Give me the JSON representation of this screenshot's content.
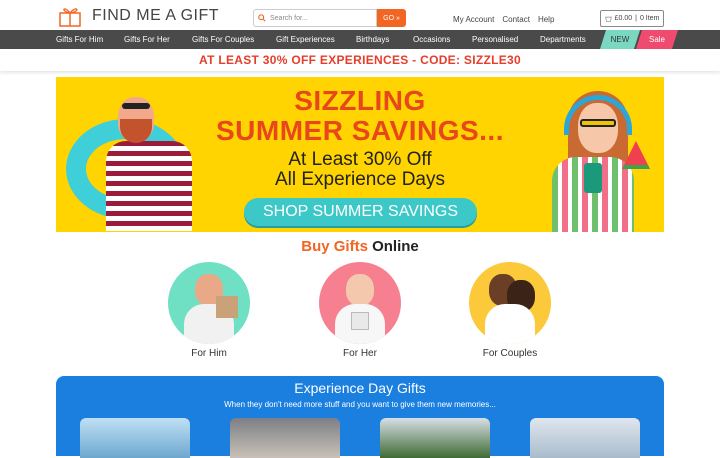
{
  "header": {
    "logo_text": "FIND ME A GIFT",
    "search_placeholder": "Search for...",
    "search_button": "GO »",
    "links": [
      "My Account",
      "Contact",
      "Help"
    ],
    "cart": {
      "amount": "£0.00",
      "separator": "|",
      "items": "0 Item"
    }
  },
  "nav": {
    "items": [
      "Gifts For Him",
      "Gifts For Her",
      "Gifts For Couples",
      "Gift Experiences",
      "Birthdays",
      "Occasions",
      "Personalised",
      "Departments"
    ],
    "new_label": "NEW",
    "sale_label": "Sale"
  },
  "promo_text": "AT LEAST 30% OFF EXPERIENCES - CODE: SIZZLE30",
  "banner": {
    "line1": "SIZZLING",
    "line2": "SUMMER SAVINGS...",
    "line3": "At Least 30% Off",
    "line4": "All Experience Days",
    "button": "SHOP SUMMER SAVINGS"
  },
  "buy_gifts": {
    "title_part1": "Buy Gifts",
    "title_part2": "Online",
    "categories": [
      {
        "label": "For Him"
      },
      {
        "label": "For Her"
      },
      {
        "label": "For Couples"
      }
    ]
  },
  "experience": {
    "title": "Experience Day Gifts",
    "subtitle": "When they don't need more stuff and you want to give them new memories..."
  },
  "colors": {
    "accent": "#f26522",
    "nav_bg": "#4a4a4a",
    "new_bg": "#7ad8c2",
    "sale_bg": "#ef4a6f",
    "banner_bg": "#ffd400",
    "experience_bg": "#1b7fe0"
  }
}
